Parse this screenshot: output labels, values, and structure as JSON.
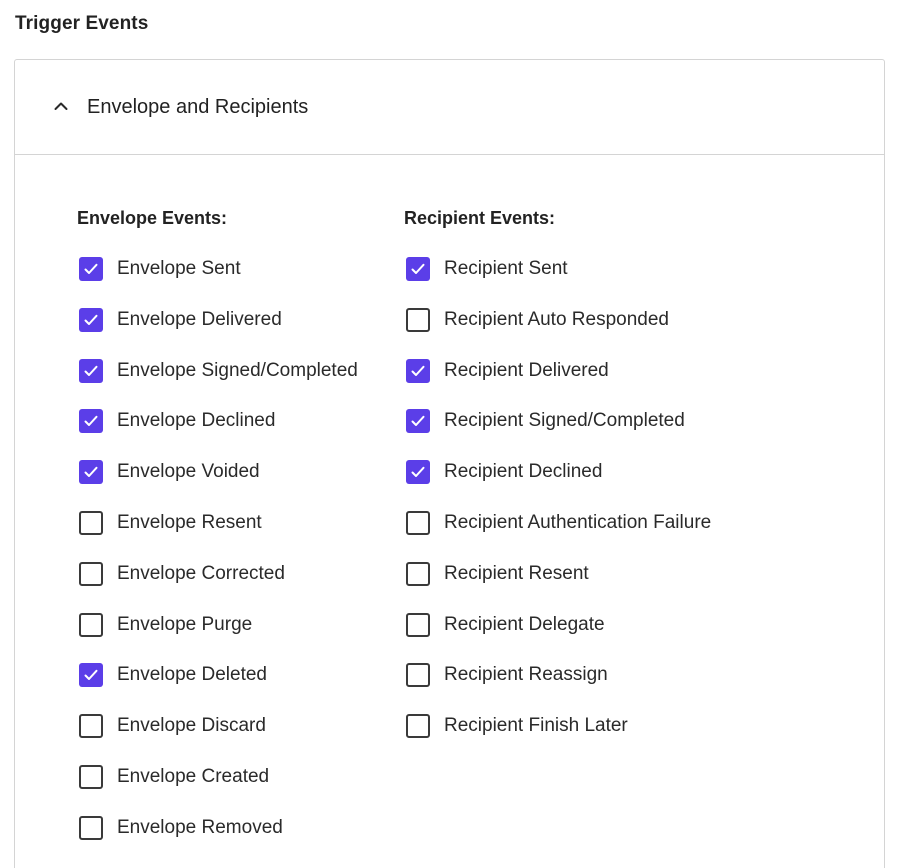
{
  "section_title": "Trigger Events",
  "accordion": {
    "label": "Envelope and Recipients",
    "expanded": true,
    "icon": "chevron-up-icon"
  },
  "accent_color": "#5b3ee8",
  "envelope_events": {
    "heading": "Envelope Events:",
    "items": [
      {
        "label": "Envelope Sent",
        "checked": true
      },
      {
        "label": "Envelope Delivered",
        "checked": true
      },
      {
        "label": "Envelope Signed/Completed",
        "checked": true
      },
      {
        "label": "Envelope Declined",
        "checked": true
      },
      {
        "label": "Envelope Voided",
        "checked": true
      },
      {
        "label": "Envelope Resent",
        "checked": false
      },
      {
        "label": "Envelope Corrected",
        "checked": false
      },
      {
        "label": "Envelope Purge",
        "checked": false
      },
      {
        "label": "Envelope Deleted",
        "checked": true
      },
      {
        "label": "Envelope Discard",
        "checked": false
      },
      {
        "label": "Envelope Created",
        "checked": false
      },
      {
        "label": "Envelope Removed",
        "checked": false
      }
    ]
  },
  "recipient_events": {
    "heading": "Recipient Events:",
    "items": [
      {
        "label": "Recipient Sent",
        "checked": true
      },
      {
        "label": "Recipient Auto Responded",
        "checked": false
      },
      {
        "label": "Recipient Delivered",
        "checked": true
      },
      {
        "label": "Recipient Signed/Completed",
        "checked": true
      },
      {
        "label": "Recipient Declined",
        "checked": true
      },
      {
        "label": "Recipient Authentication Failure",
        "checked": false
      },
      {
        "label": "Recipient Resent",
        "checked": false
      },
      {
        "label": "Recipient Delegate",
        "checked": false
      },
      {
        "label": "Recipient Reassign",
        "checked": false
      },
      {
        "label": "Recipient Finish Later",
        "checked": false
      }
    ]
  }
}
